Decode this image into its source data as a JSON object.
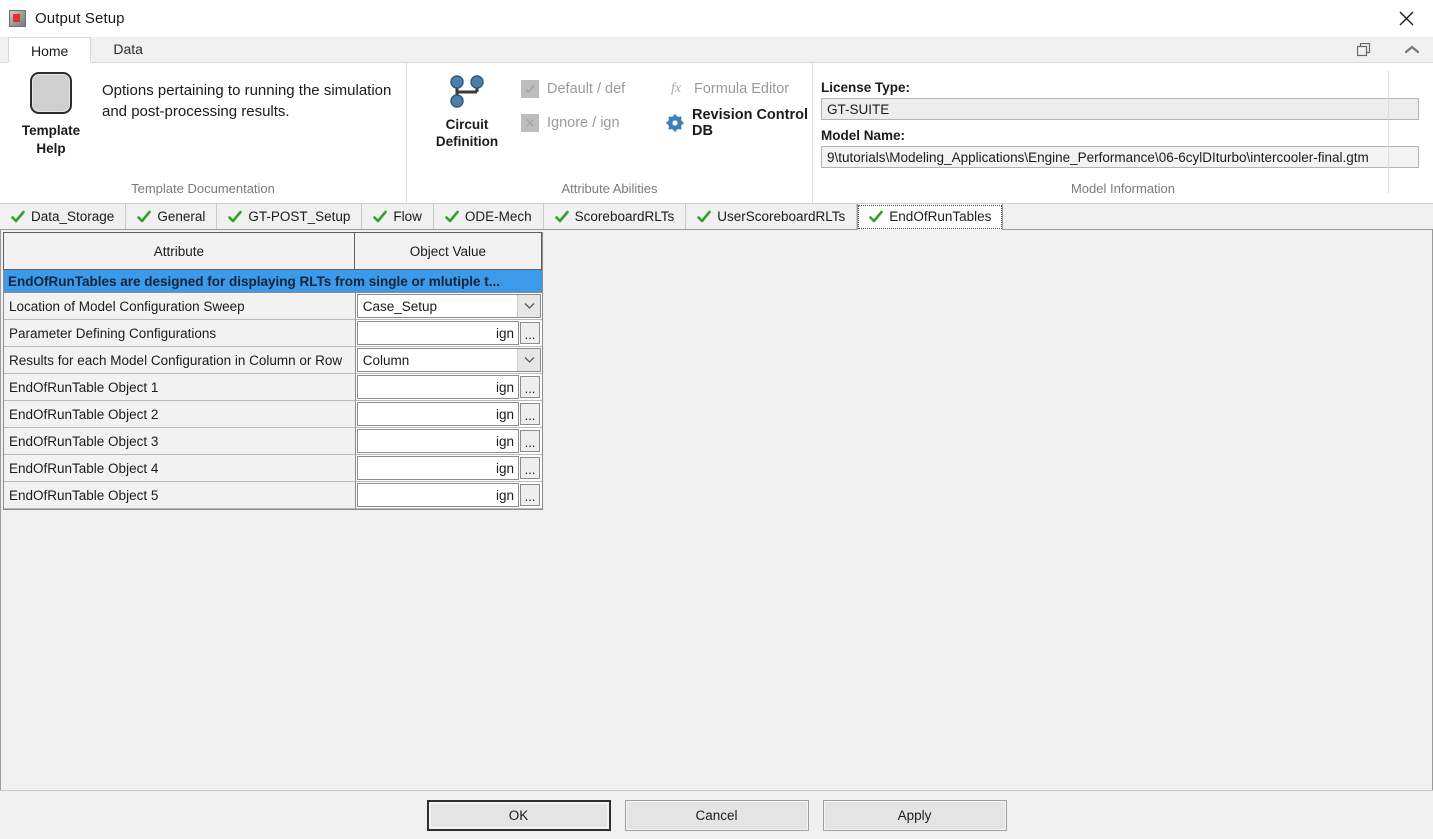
{
  "window": {
    "title": "Output Setup",
    "icon": "app-icon",
    "close_label": "✕"
  },
  "ribbon": {
    "tabs": [
      {
        "label": "Home",
        "active": true
      },
      {
        "label": "Data",
        "active": false
      }
    ],
    "corner_icons": [
      "restore-window-icon",
      "collapse-ribbon-icon"
    ],
    "groups": {
      "documentation": {
        "title": "Template Documentation",
        "button_label": "Template\nHelp",
        "button_label_line1": "Template",
        "button_label_line2": "Help",
        "description": "Options pertaining to running the simulation and post-processing results."
      },
      "attributes": {
        "title": "Attribute Abilities",
        "circuit_label_line1": "Circuit",
        "circuit_label_line2": "Definition",
        "items": [
          {
            "label": "Default / def",
            "icon": "checkbox-checked-icon",
            "enabled": false
          },
          {
            "label": "Formula Editor",
            "icon": "fx-icon",
            "enabled": false
          },
          {
            "label": "Ignore / ign",
            "icon": "checkbox-crossed-icon",
            "enabled": false
          },
          {
            "label": "Revision Control DB",
            "icon": "gear-icon",
            "enabled": true
          }
        ]
      },
      "model_information": {
        "title": "Model Information",
        "license_label": "License Type:",
        "license_value": "GT-SUITE",
        "model_label": "Model Name:",
        "model_value": "9\\tutorials\\Modeling_Applications\\Engine_Performance\\06-6cylDIturbo\\intercooler-final.gtm"
      }
    }
  },
  "section_tabs": [
    {
      "label": "Data_Storage",
      "active": false
    },
    {
      "label": "General",
      "active": false
    },
    {
      "label": "GT-POST_Setup",
      "active": false
    },
    {
      "label": "Flow",
      "active": false
    },
    {
      "label": "ODE-Mech",
      "active": false
    },
    {
      "label": "ScoreboardRLTs",
      "active": false
    },
    {
      "label": "UserScoreboardRLTs",
      "active": false
    },
    {
      "label": "EndOfRunTables",
      "active": true
    }
  ],
  "table": {
    "headers": [
      "Attribute",
      "Object Value"
    ],
    "banner": "EndOfRunTables are designed for displaying RLTs from single or mlutiple t...",
    "rows": [
      {
        "attribute": "Location of Model Configuration Sweep",
        "value": "Case_Setup",
        "type": "combo"
      },
      {
        "attribute": "Parameter Defining Configurations",
        "value": "ign",
        "type": "object",
        "browse": "..."
      },
      {
        "attribute": "Results for each Model Configuration in Column or Row",
        "value": "Column",
        "type": "combo"
      },
      {
        "attribute": "EndOfRunTable Object 1",
        "value": "ign",
        "type": "object",
        "browse": "..."
      },
      {
        "attribute": "EndOfRunTable Object 2",
        "value": "ign",
        "type": "object",
        "browse": "..."
      },
      {
        "attribute": "EndOfRunTable Object 3",
        "value": "ign",
        "type": "object",
        "browse": "..."
      },
      {
        "attribute": "EndOfRunTable Object 4",
        "value": "ign",
        "type": "object",
        "browse": "..."
      },
      {
        "attribute": "EndOfRunTable Object 5",
        "value": "ign",
        "type": "object",
        "browse": "..."
      }
    ]
  },
  "footer": {
    "ok": "OK",
    "cancel": "Cancel",
    "apply": "Apply"
  },
  "colors": {
    "banner_blue": "#3d9ae8",
    "check_green": "#33a02c",
    "icon_blue": "#3b6e9e",
    "ribbon_bg": "#ffffff",
    "panel_gray": "#f0f0f0"
  }
}
